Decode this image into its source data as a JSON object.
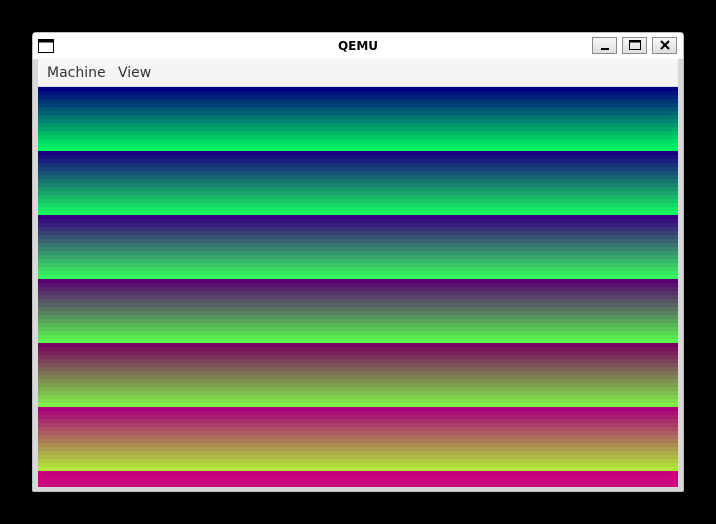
{
  "window": {
    "title": "QEMU",
    "icon": "window-icon",
    "controls": [
      "minimize-icon",
      "maximize-icon",
      "close-icon"
    ]
  },
  "menubar": {
    "items": [
      {
        "label": "Machine"
      },
      {
        "label": "View"
      }
    ]
  },
  "display": {
    "pattern": "horizontal color gradient bands",
    "bands": [
      {
        "red": [
          0,
          0
        ],
        "green": [
          0,
          248
        ],
        "blue": [
          128,
          96
        ]
      },
      {
        "red": [
          24,
          24
        ],
        "green": [
          0,
          248
        ],
        "blue": [
          128,
          96
        ]
      },
      {
        "red": [
          56,
          56
        ],
        "green": [
          0,
          248
        ],
        "blue": [
          128,
          96
        ]
      },
      {
        "red": [
          88,
          88
        ],
        "green": [
          0,
          248
        ],
        "blue": [
          112,
          80
        ]
      },
      {
        "red": [
          120,
          128
        ],
        "green": [
          0,
          240
        ],
        "blue": [
          96,
          72
        ]
      },
      {
        "red": [
          168,
          176
        ],
        "green": [
          0,
          232
        ],
        "blue": [
          120,
          56
        ]
      },
      {
        "red": [
          200,
          200
        ],
        "green": [
          0,
          64
        ],
        "blue": [
          128,
          112
        ]
      }
    ]
  }
}
